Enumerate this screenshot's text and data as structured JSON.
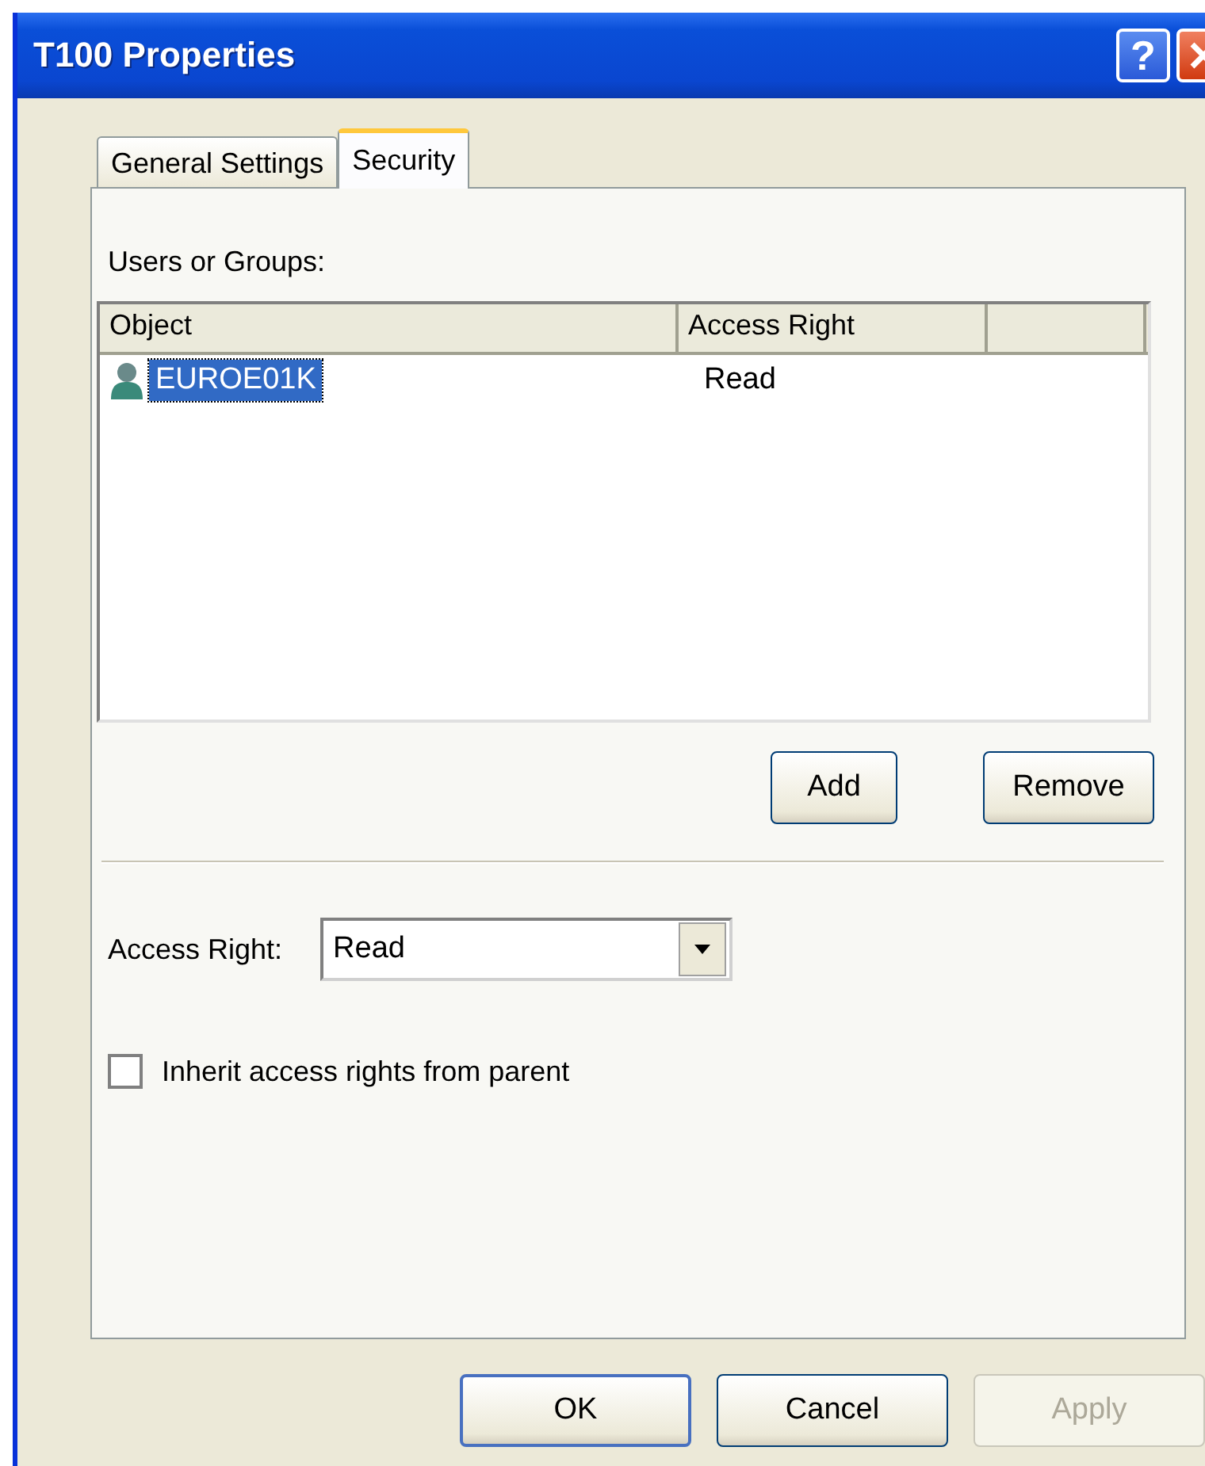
{
  "window": {
    "title": "T100 Properties",
    "help_button": "?"
  },
  "tabs": [
    {
      "label": "General Settings",
      "selected": false
    },
    {
      "label": "Security",
      "selected": true
    }
  ],
  "users_label": "Users or Groups:",
  "list": {
    "columns": [
      "Object",
      "Access Right"
    ],
    "rows": [
      {
        "object": "EUROE01K",
        "access_right": "Read",
        "selected": true
      }
    ]
  },
  "list_buttons": [
    "Add",
    "Remove"
  ],
  "access_right": {
    "label": "Access Right:",
    "value": "Read"
  },
  "inherit": {
    "label": "Inherit access rights from parent",
    "checked": false
  },
  "dialog_buttons": [
    {
      "label": "OK",
      "disabled": false,
      "default": true
    },
    {
      "label": "Cancel",
      "disabled": false,
      "default": false
    },
    {
      "label": "Apply",
      "disabled": true,
      "default": false
    }
  ]
}
